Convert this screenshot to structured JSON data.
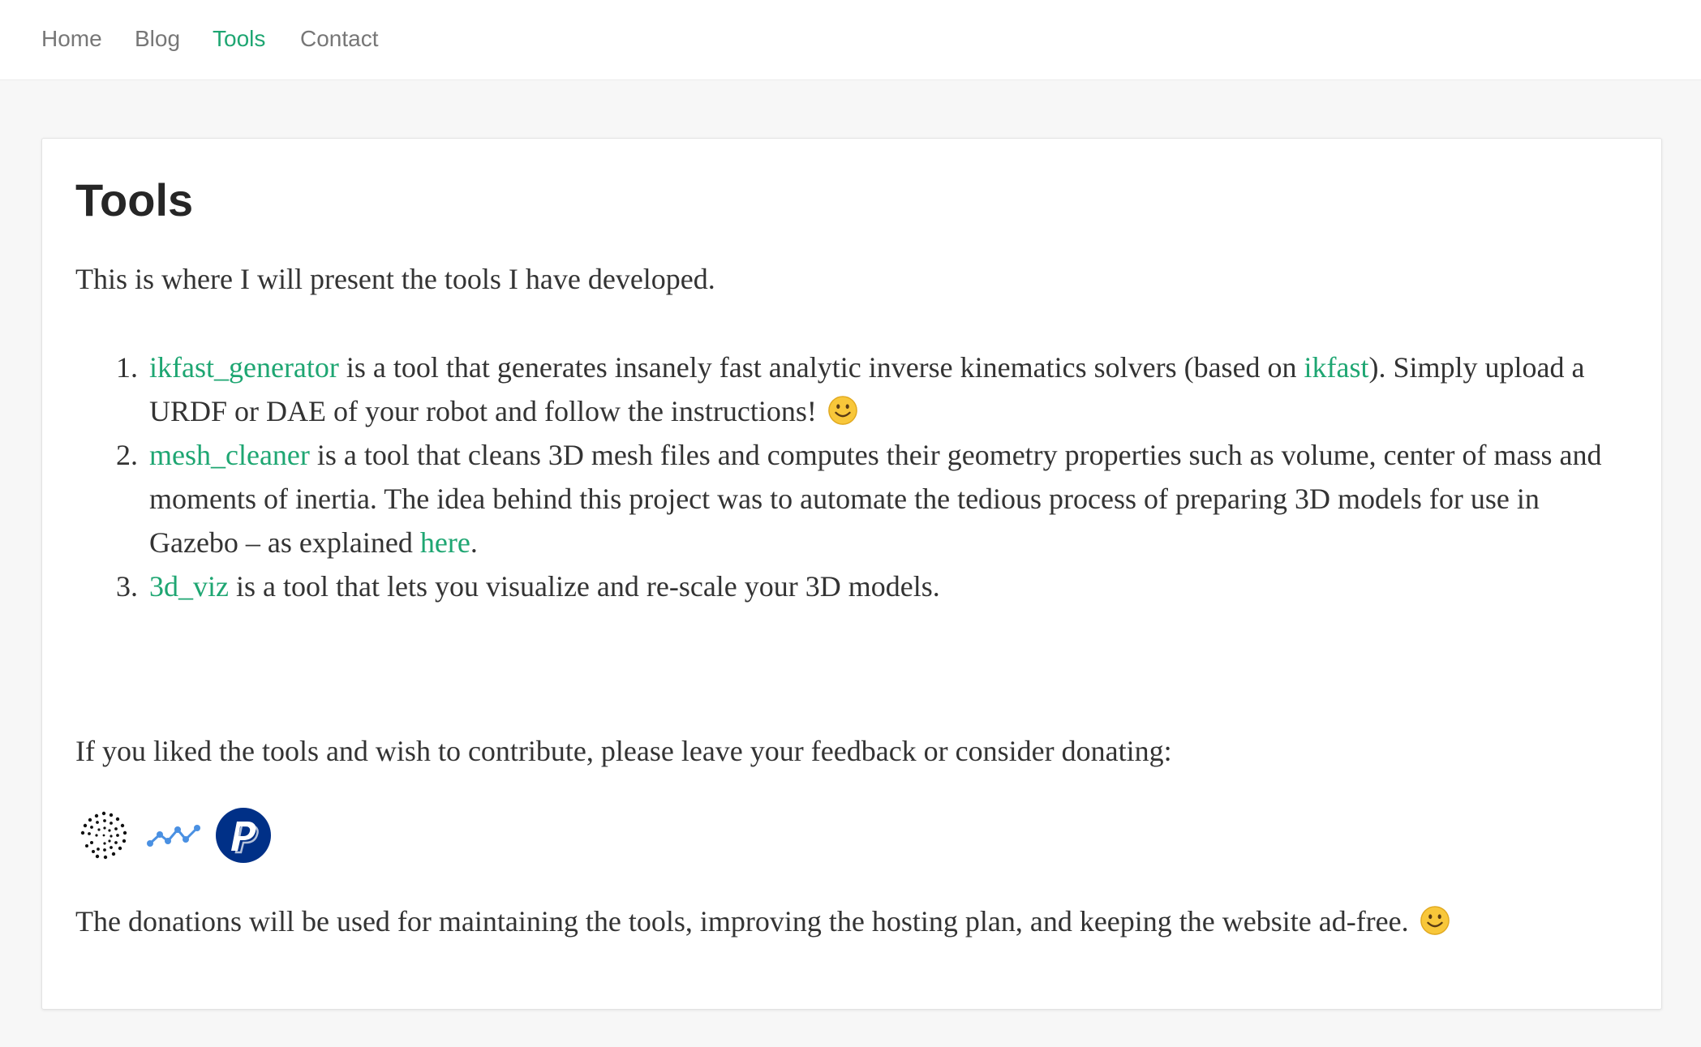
{
  "nav": {
    "items": [
      {
        "label": "Home",
        "active": false
      },
      {
        "label": "Blog",
        "active": false
      },
      {
        "label": "Tools",
        "active": true
      },
      {
        "label": "Contact",
        "active": false
      }
    ]
  },
  "colors": {
    "accent": "#1ea672",
    "text": "#333333",
    "nav_text": "#777777",
    "background": "#f7f7f7",
    "paypal": "#003087"
  },
  "main": {
    "title": "Tools",
    "intro": "This is where I will present the tools I have developed.",
    "tools": [
      {
        "number": "1.",
        "name": "ikfast_generator",
        "desc_before_link": " is a tool that generates insanely fast analytic inverse kinematics solvers (based on ",
        "inline_link": "ikfast",
        "desc_after_link": "). Simply upload a URDF or DAE of your robot and follow the instructions!",
        "trailing_icon": "smiley-emoji-icon"
      },
      {
        "number": "2.",
        "name": "mesh_cleaner",
        "desc_before_link": " is a tool that cleans 3D mesh files and computes their geometry properties such as volume, center of mass and moments of inertia. The idea behind this project was to automate the tedious process of preparing 3D models for use in Gazebo – as explained ",
        "inline_link": "here",
        "desc_after_link": "."
      },
      {
        "number": "3.",
        "name": "3d_viz",
        "desc": " is a tool that lets you visualize and re-scale your 3D models."
      }
    ],
    "contribute_text": "If you liked the tools and wish to contribute, please leave your feedback or consider donating:",
    "donate_icons": [
      "iota-icon",
      "nano-icon",
      "paypal-icon"
    ],
    "donations_note": "The donations will be used for maintaining the tools, improving the hosting plan, and keeping the website ad-free.",
    "donations_note_icon": "smiley-emoji-icon"
  }
}
